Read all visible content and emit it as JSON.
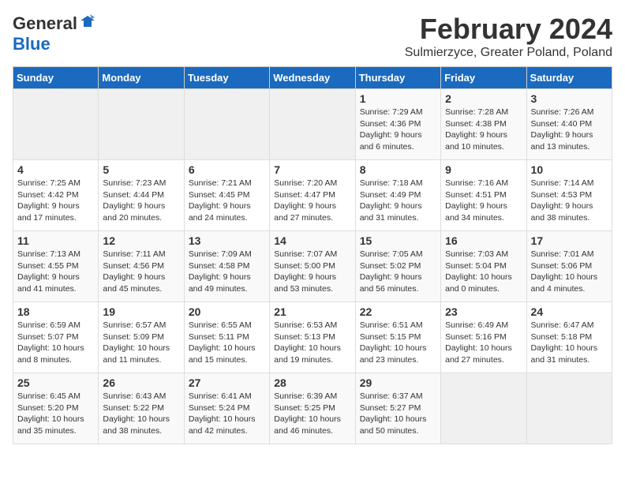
{
  "header": {
    "logo_general": "General",
    "logo_blue": "Blue",
    "month": "February 2024",
    "location": "Sulmierzyce, Greater Poland, Poland"
  },
  "weekdays": [
    "Sunday",
    "Monday",
    "Tuesday",
    "Wednesday",
    "Thursday",
    "Friday",
    "Saturday"
  ],
  "weeks": [
    [
      {
        "day": "",
        "empty": true
      },
      {
        "day": "",
        "empty": true
      },
      {
        "day": "",
        "empty": true
      },
      {
        "day": "",
        "empty": true
      },
      {
        "day": "1",
        "sunrise": "Sunrise: 7:29 AM",
        "sunset": "Sunset: 4:36 PM",
        "daylight": "Daylight: 9 hours and 6 minutes."
      },
      {
        "day": "2",
        "sunrise": "Sunrise: 7:28 AM",
        "sunset": "Sunset: 4:38 PM",
        "daylight": "Daylight: 9 hours and 10 minutes."
      },
      {
        "day": "3",
        "sunrise": "Sunrise: 7:26 AM",
        "sunset": "Sunset: 4:40 PM",
        "daylight": "Daylight: 9 hours and 13 minutes."
      }
    ],
    [
      {
        "day": "4",
        "sunrise": "Sunrise: 7:25 AM",
        "sunset": "Sunset: 4:42 PM",
        "daylight": "Daylight: 9 hours and 17 minutes."
      },
      {
        "day": "5",
        "sunrise": "Sunrise: 7:23 AM",
        "sunset": "Sunset: 4:44 PM",
        "daylight": "Daylight: 9 hours and 20 minutes."
      },
      {
        "day": "6",
        "sunrise": "Sunrise: 7:21 AM",
        "sunset": "Sunset: 4:45 PM",
        "daylight": "Daylight: 9 hours and 24 minutes."
      },
      {
        "day": "7",
        "sunrise": "Sunrise: 7:20 AM",
        "sunset": "Sunset: 4:47 PM",
        "daylight": "Daylight: 9 hours and 27 minutes."
      },
      {
        "day": "8",
        "sunrise": "Sunrise: 7:18 AM",
        "sunset": "Sunset: 4:49 PM",
        "daylight": "Daylight: 9 hours and 31 minutes."
      },
      {
        "day": "9",
        "sunrise": "Sunrise: 7:16 AM",
        "sunset": "Sunset: 4:51 PM",
        "daylight": "Daylight: 9 hours and 34 minutes."
      },
      {
        "day": "10",
        "sunrise": "Sunrise: 7:14 AM",
        "sunset": "Sunset: 4:53 PM",
        "daylight": "Daylight: 9 hours and 38 minutes."
      }
    ],
    [
      {
        "day": "11",
        "sunrise": "Sunrise: 7:13 AM",
        "sunset": "Sunset: 4:55 PM",
        "daylight": "Daylight: 9 hours and 41 minutes."
      },
      {
        "day": "12",
        "sunrise": "Sunrise: 7:11 AM",
        "sunset": "Sunset: 4:56 PM",
        "daylight": "Daylight: 9 hours and 45 minutes."
      },
      {
        "day": "13",
        "sunrise": "Sunrise: 7:09 AM",
        "sunset": "Sunset: 4:58 PM",
        "daylight": "Daylight: 9 hours and 49 minutes."
      },
      {
        "day": "14",
        "sunrise": "Sunrise: 7:07 AM",
        "sunset": "Sunset: 5:00 PM",
        "daylight": "Daylight: 9 hours and 53 minutes."
      },
      {
        "day": "15",
        "sunrise": "Sunrise: 7:05 AM",
        "sunset": "Sunset: 5:02 PM",
        "daylight": "Daylight: 9 hours and 56 minutes."
      },
      {
        "day": "16",
        "sunrise": "Sunrise: 7:03 AM",
        "sunset": "Sunset: 5:04 PM",
        "daylight": "Daylight: 10 hours and 0 minutes."
      },
      {
        "day": "17",
        "sunrise": "Sunrise: 7:01 AM",
        "sunset": "Sunset: 5:06 PM",
        "daylight": "Daylight: 10 hours and 4 minutes."
      }
    ],
    [
      {
        "day": "18",
        "sunrise": "Sunrise: 6:59 AM",
        "sunset": "Sunset: 5:07 PM",
        "daylight": "Daylight: 10 hours and 8 minutes."
      },
      {
        "day": "19",
        "sunrise": "Sunrise: 6:57 AM",
        "sunset": "Sunset: 5:09 PM",
        "daylight": "Daylight: 10 hours and 11 minutes."
      },
      {
        "day": "20",
        "sunrise": "Sunrise: 6:55 AM",
        "sunset": "Sunset: 5:11 PM",
        "daylight": "Daylight: 10 hours and 15 minutes."
      },
      {
        "day": "21",
        "sunrise": "Sunrise: 6:53 AM",
        "sunset": "Sunset: 5:13 PM",
        "daylight": "Daylight: 10 hours and 19 minutes."
      },
      {
        "day": "22",
        "sunrise": "Sunrise: 6:51 AM",
        "sunset": "Sunset: 5:15 PM",
        "daylight": "Daylight: 10 hours and 23 minutes."
      },
      {
        "day": "23",
        "sunrise": "Sunrise: 6:49 AM",
        "sunset": "Sunset: 5:16 PM",
        "daylight": "Daylight: 10 hours and 27 minutes."
      },
      {
        "day": "24",
        "sunrise": "Sunrise: 6:47 AM",
        "sunset": "Sunset: 5:18 PM",
        "daylight": "Daylight: 10 hours and 31 minutes."
      }
    ],
    [
      {
        "day": "25",
        "sunrise": "Sunrise: 6:45 AM",
        "sunset": "Sunset: 5:20 PM",
        "daylight": "Daylight: 10 hours and 35 minutes."
      },
      {
        "day": "26",
        "sunrise": "Sunrise: 6:43 AM",
        "sunset": "Sunset: 5:22 PM",
        "daylight": "Daylight: 10 hours and 38 minutes."
      },
      {
        "day": "27",
        "sunrise": "Sunrise: 6:41 AM",
        "sunset": "Sunset: 5:24 PM",
        "daylight": "Daylight: 10 hours and 42 minutes."
      },
      {
        "day": "28",
        "sunrise": "Sunrise: 6:39 AM",
        "sunset": "Sunset: 5:25 PM",
        "daylight": "Daylight: 10 hours and 46 minutes."
      },
      {
        "day": "29",
        "sunrise": "Sunrise: 6:37 AM",
        "sunset": "Sunset: 5:27 PM",
        "daylight": "Daylight: 10 hours and 50 minutes."
      },
      {
        "day": "",
        "empty": true
      },
      {
        "day": "",
        "empty": true
      }
    ]
  ]
}
